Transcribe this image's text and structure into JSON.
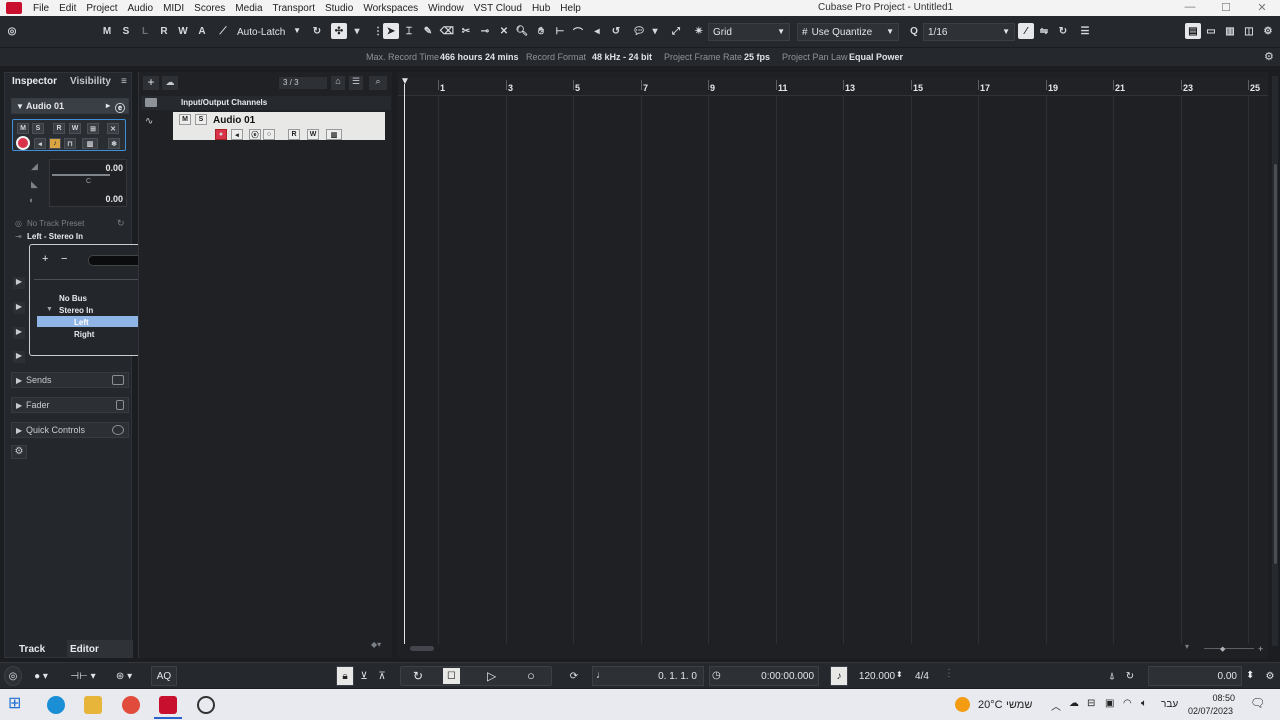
{
  "menubar": {
    "items": [
      "File",
      "Edit",
      "Project",
      "Audio",
      "MIDI",
      "Scores",
      "Media",
      "Transport",
      "Studio",
      "Workspaces",
      "Window",
      "VST Cloud",
      "Hub",
      "Help"
    ],
    "window_title": "Cubase Pro Project - Untitled1"
  },
  "toolbar": {
    "state_buttons": [
      "M",
      "S",
      "L",
      "R",
      "W",
      "A"
    ],
    "automation_mode": "Auto-Latch",
    "snap_type": "Grid",
    "quantize_mode": "Use Quantize",
    "quantize_value": "1/16"
  },
  "infoline": {
    "max_record_label": "Max. Record Time",
    "max_record_value": "466 hours 24 mins",
    "record_format_label": "Record Format",
    "record_format_value": "48 kHz - 24 bit",
    "frame_rate_label": "Project Frame Rate",
    "frame_rate_value": "25 fps",
    "pan_law_label": "Project Pan Law",
    "pan_law_value": "Equal Power"
  },
  "inspector": {
    "tabs": [
      "Inspector",
      "Visibility"
    ],
    "track_name": "Audio 01",
    "channel_buttons": [
      "M",
      "S",
      "R",
      "W"
    ],
    "volume_value": "0.00",
    "pan_value": "C",
    "delay_value": "0.00",
    "track_preset": "No Track Preset",
    "input_routing": "Left - Stereo In",
    "sections": [
      "Sends",
      "Fader",
      "Quick Controls"
    ],
    "bottom_tabs": [
      "Track",
      "Editor"
    ]
  },
  "routing_popup": {
    "items": [
      {
        "label": "No Bus",
        "level": 0,
        "selected": false,
        "expandable": false
      },
      {
        "label": "Stereo In",
        "level": 0,
        "selected": false,
        "expandable": true
      },
      {
        "label": "Left",
        "level": 1,
        "selected": true,
        "expandable": false
      },
      {
        "label": "Right",
        "level": 1,
        "selected": false,
        "expandable": false
      }
    ]
  },
  "tracklist": {
    "track_count": "3 / 3",
    "folder_name": "Input/Output Channels",
    "track_name": "Audio 01",
    "track_buttons": [
      "M",
      "S"
    ]
  },
  "ruler": {
    "bars": [
      "1",
      "3",
      "5",
      "7",
      "9",
      "11",
      "13",
      "15",
      "17",
      "19",
      "21",
      "23",
      "25"
    ]
  },
  "transport": {
    "position": "0.  1.  1.    0",
    "time": "0:00:00.000",
    "tempo": "120.000",
    "signature": "4/4",
    "right_value": "0.00",
    "aq_label": "AQ"
  },
  "taskbar": {
    "weather": "20°C",
    "weather_text": "שמשי",
    "lang": "עבר",
    "clock_time": "08:50",
    "clock_date": "02/07/2023"
  },
  "colors": {
    "accent_red": "#c8102e",
    "selection": "#8fb5e6",
    "record_red": "#d9334a"
  }
}
